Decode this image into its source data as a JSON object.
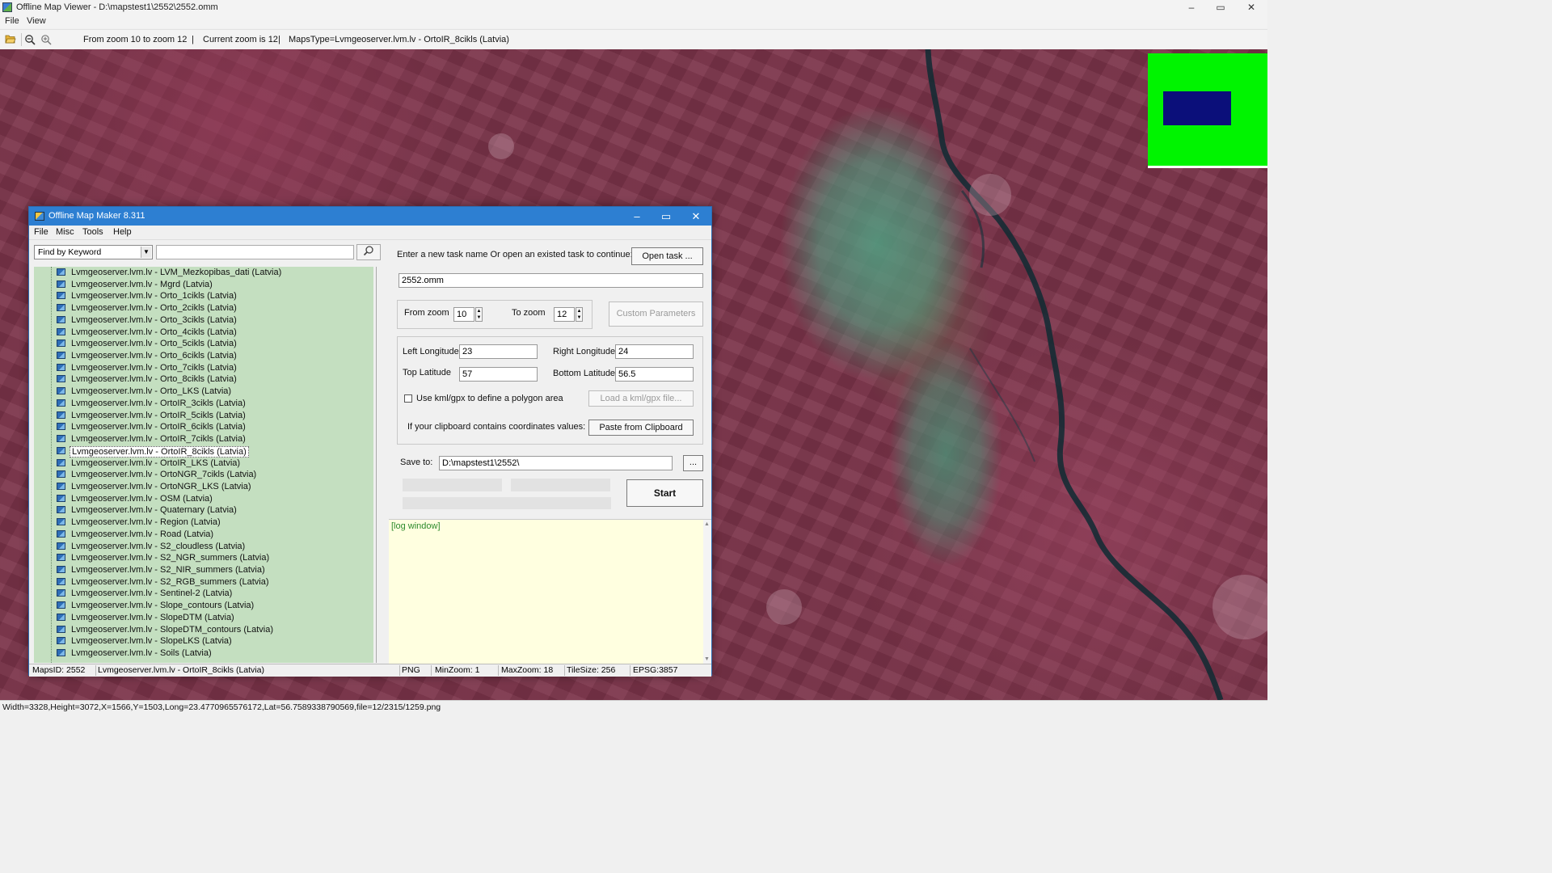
{
  "window": {
    "title": "Offline Map Viewer - D:\\mapstest1\\2552\\2552.omm",
    "controls": {
      "minimize": "–",
      "maximize": "▭",
      "close": "✕"
    }
  },
  "menu": {
    "file": "File",
    "view": "View"
  },
  "toolbar": {
    "zoom_range": "From zoom 10 to zoom 12",
    "current_zoom": "Current zoom is 12",
    "maps_type": "MapsType=Lvmgeoserver.lvm.lv - OrtoIR_8cikls (Latvia)",
    "separator": "|",
    "icons": [
      "open-folder-icon",
      "zoom-out-icon",
      "zoom-in-icon"
    ]
  },
  "status_bar": {
    "text": "Width=3328,Height=3072,X=1566,Y=1503,Long=23.4770965576172,Lat=56.7589338790569,file=12/2315/1259.png"
  },
  "colors": {
    "map_base": "#7b3349",
    "overview_bg": "#00f400",
    "overview_viewport": "#0b0f7a",
    "dialog_title": "#2d7fd2",
    "tree_bg": "#c4dfc0",
    "log_bg": "#ffffe0"
  },
  "dialog": {
    "title": "Offline Map Maker 8.311",
    "menu": {
      "file": "File",
      "misc": "Misc",
      "tools": "Tools",
      "help": "Help"
    },
    "search": {
      "mode": "Find by Keyword",
      "keyword": ""
    },
    "tree_items": [
      "Lvmgeoserver.lvm.lv - LVM_Mezkopibas_dati (Latvia)",
      "Lvmgeoserver.lvm.lv - Mgrd (Latvia)",
      "Lvmgeoserver.lvm.lv - Orto_1cikls (Latvia)",
      "Lvmgeoserver.lvm.lv - Orto_2cikls (Latvia)",
      "Lvmgeoserver.lvm.lv - Orto_3cikls (Latvia)",
      "Lvmgeoserver.lvm.lv - Orto_4cikls (Latvia)",
      "Lvmgeoserver.lvm.lv - Orto_5cikls (Latvia)",
      "Lvmgeoserver.lvm.lv - Orto_6cikls (Latvia)",
      "Lvmgeoserver.lvm.lv - Orto_7cikls (Latvia)",
      "Lvmgeoserver.lvm.lv - Orto_8cikls (Latvia)",
      "Lvmgeoserver.lvm.lv - Orto_LKS (Latvia)",
      "Lvmgeoserver.lvm.lv - OrtoIR_3cikls (Latvia)",
      "Lvmgeoserver.lvm.lv - OrtoIR_5cikls (Latvia)",
      "Lvmgeoserver.lvm.lv - OrtoIR_6cikls (Latvia)",
      "Lvmgeoserver.lvm.lv - OrtoIR_7cikls (Latvia)",
      "Lvmgeoserver.lvm.lv - OrtoIR_8cikls (Latvia)",
      "Lvmgeoserver.lvm.lv - OrtoIR_LKS (Latvia)",
      "Lvmgeoserver.lvm.lv - OrtoNGR_7cikls (Latvia)",
      "Lvmgeoserver.lvm.lv - OrtoNGR_LKS (Latvia)",
      "Lvmgeoserver.lvm.lv - OSM (Latvia)",
      "Lvmgeoserver.lvm.lv - Quaternary (Latvia)",
      "Lvmgeoserver.lvm.lv - Region (Latvia)",
      "Lvmgeoserver.lvm.lv - Road (Latvia)",
      "Lvmgeoserver.lvm.lv - S2_cloudless (Latvia)",
      "Lvmgeoserver.lvm.lv - S2_NGR_summers (Latvia)",
      "Lvmgeoserver.lvm.lv - S2_NIR_summers (Latvia)",
      "Lvmgeoserver.lvm.lv - S2_RGB_summers (Latvia)",
      "Lvmgeoserver.lvm.lv - Sentinel-2 (Latvia)",
      "Lvmgeoserver.lvm.lv - Slope_contours (Latvia)",
      "Lvmgeoserver.lvm.lv - SlopeDTM (Latvia)",
      "Lvmgeoserver.lvm.lv - SlopeDTM_contours (Latvia)",
      "Lvmgeoserver.lvm.lv - SlopeLKS (Latvia)",
      "Lvmgeoserver.lvm.lv - Soils (Latvia)"
    ],
    "selected_item": "Lvmgeoserver.lvm.lv - OrtoIR_8cikls (Latvia)",
    "task_prompt": "Enter a new task name Or open an existed task to continue:",
    "open_task_label": "Open task ...",
    "task_name": "2552.omm",
    "from_zoom_label": "From zoom",
    "from_zoom": "10",
    "to_zoom_label": "To zoom",
    "to_zoom": "12",
    "custom_params_label": "Custom Parameters",
    "left_lon_label": "Left Longitude",
    "left_lon": "23",
    "right_lon_label": "Right Longitude",
    "right_lon": "24",
    "top_lat_label": "Top Latitude",
    "top_lat": "57",
    "bottom_lat_label": "Bottom Latitude",
    "bottom_lat": "56.5",
    "kml_label": "Use kml/gpx to define a polygon area",
    "kml_checked": false,
    "load_kml_label": "Load a kml/gpx file...",
    "clipboard_text": "If your clipboard contains coordinates values:",
    "paste_label": "Paste from Clipboard",
    "save_to_label": "Save to:",
    "save_to": "D:\\mapstest1\\2552\\",
    "browse_label": "...",
    "start_label": "Start",
    "log_text": "[log window]",
    "status": {
      "maps_id": "MapsID: 2552",
      "maps_name": "Lvmgeoserver.lvm.lv - OrtoIR_8cikls (Latvia)",
      "format": "PNG",
      "min_zoom": "MinZoom: 1",
      "max_zoom": "MaxZoom: 18",
      "tile_size": "TileSize: 256",
      "epsg": "EPSG:3857"
    }
  }
}
